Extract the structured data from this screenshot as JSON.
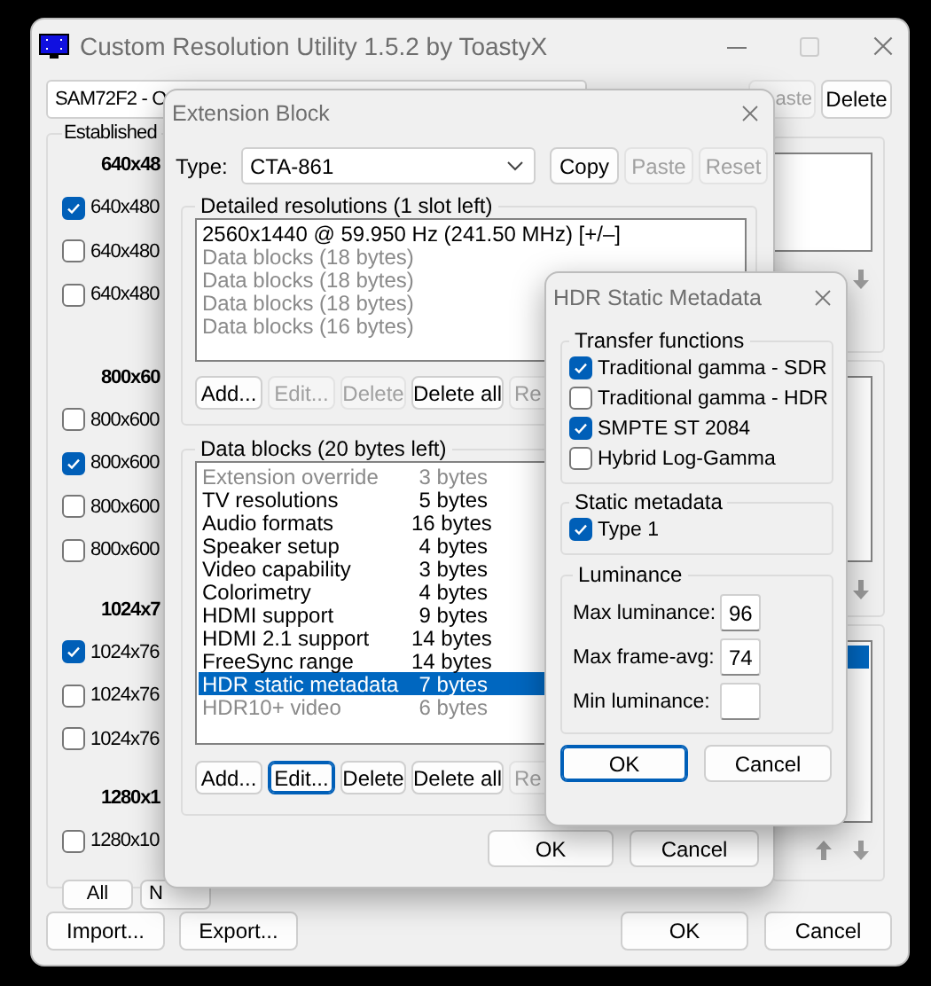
{
  "main_window": {
    "title": "Custom Resolution Utility 1.5.2 by ToastyX",
    "display_select": "SAM72F2 - O",
    "top_buttons": [
      {
        "label": "aste",
        "disabled": true
      },
      {
        "label": "Delete",
        "disabled": false
      }
    ],
    "established": {
      "title": "Established",
      "sections": [
        {
          "header": "640x48",
          "items": [
            {
              "label": "640x480",
              "checked": true
            },
            {
              "label": "640x480",
              "checked": false
            },
            {
              "label": "640x480",
              "checked": false
            }
          ]
        },
        {
          "header": "800x60",
          "items": [
            {
              "label": "800x600",
              "checked": false
            },
            {
              "label": "800x600",
              "checked": true
            },
            {
              "label": "800x600",
              "checked": false
            },
            {
              "label": "800x600",
              "checked": false
            }
          ]
        },
        {
          "header": "1024x7",
          "items": [
            {
              "label": "1024x76",
              "checked": true
            },
            {
              "label": "1024x76",
              "checked": false
            },
            {
              "label": "1024x76",
              "checked": false
            }
          ]
        },
        {
          "header": "1280x1",
          "items": [
            {
              "label": "1280x10",
              "checked": false
            }
          ]
        }
      ],
      "buttons": [
        "All",
        "N"
      ]
    },
    "right_panels": [
      {
        "highlighted_row": false
      },
      {
        "highlighted_row": false
      },
      {
        "highlighted_row": true
      }
    ],
    "footer_left": [
      "Import...",
      "Export..."
    ],
    "footer_right": [
      "OK",
      "Cancel"
    ]
  },
  "extension_block": {
    "title": "Extension Block",
    "type_label": "Type:",
    "type_value": "CTA-861",
    "type_buttons": [
      {
        "label": "Copy",
        "disabled": false
      },
      {
        "label": "Paste",
        "disabled": true
      },
      {
        "label": "Reset",
        "disabled": true
      }
    ],
    "detailed": {
      "title": "Detailed resolutions (1 slot left)",
      "rows": [
        {
          "text": "2560x1440 @ 59.950 Hz (241.50 MHz) [+/–]",
          "disabled": false
        },
        {
          "text": "Data blocks (18 bytes)",
          "disabled": true
        },
        {
          "text": "Data blocks (18 bytes)",
          "disabled": true
        },
        {
          "text": "Data blocks (18 bytes)",
          "disabled": true
        },
        {
          "text": "Data blocks (16 bytes)",
          "disabled": true
        }
      ],
      "buttons": [
        {
          "label": "Add...",
          "disabled": false
        },
        {
          "label": "Edit...",
          "disabled": true
        },
        {
          "label": "Delete",
          "disabled": true
        },
        {
          "label": "Delete all",
          "disabled": false
        },
        {
          "label": "Re",
          "disabled": true
        }
      ]
    },
    "data_blocks": {
      "title": "Data blocks (20 bytes left)",
      "rows": [
        {
          "name": "Extension override",
          "size": "3 bytes",
          "disabled": true,
          "selected": false
        },
        {
          "name": "TV resolutions",
          "size": "5 bytes",
          "disabled": false,
          "selected": false
        },
        {
          "name": "Audio formats",
          "size": "16 bytes",
          "disabled": false,
          "selected": false
        },
        {
          "name": "Speaker setup",
          "size": "4 bytes",
          "disabled": false,
          "selected": false
        },
        {
          "name": "Video capability",
          "size": "3 bytes",
          "disabled": false,
          "selected": false
        },
        {
          "name": "Colorimetry",
          "size": "4 bytes",
          "disabled": false,
          "selected": false
        },
        {
          "name": "HDMI support",
          "size": "9 bytes",
          "disabled": false,
          "selected": false
        },
        {
          "name": "HDMI 2.1 support",
          "size": "14 bytes",
          "disabled": false,
          "selected": false
        },
        {
          "name": "FreeSync range",
          "size": "14 bytes",
          "disabled": false,
          "selected": false
        },
        {
          "name": "HDR static metadata",
          "size": "7 bytes",
          "disabled": false,
          "selected": true
        },
        {
          "name": "HDR10+ video",
          "size": "6 bytes",
          "disabled": true,
          "selected": false
        }
      ],
      "buttons": [
        {
          "label": "Add...",
          "disabled": false,
          "focused": false
        },
        {
          "label": "Edit...",
          "disabled": false,
          "focused": true
        },
        {
          "label": "Delete",
          "disabled": false,
          "focused": false
        },
        {
          "label": "Delete all",
          "disabled": false,
          "focused": false
        },
        {
          "label": "Re",
          "disabled": true,
          "focused": false
        }
      ]
    },
    "footer_buttons": [
      "OK",
      "Cancel"
    ]
  },
  "hdr_dialog": {
    "title": "HDR Static Metadata",
    "transfer_functions": {
      "title": "Transfer functions",
      "items": [
        {
          "label": "Traditional gamma - SDR",
          "checked": true
        },
        {
          "label": "Traditional gamma - HDR",
          "checked": false
        },
        {
          "label": "SMPTE ST 2084",
          "checked": true
        },
        {
          "label": "Hybrid Log-Gamma",
          "checked": false
        }
      ]
    },
    "static_metadata": {
      "title": "Static metadata",
      "items": [
        {
          "label": "Type 1",
          "checked": true
        }
      ]
    },
    "luminance": {
      "title": "Luminance",
      "fields": [
        {
          "label": "Max luminance:",
          "value": "96"
        },
        {
          "label": "Max frame-avg:",
          "value": "74"
        },
        {
          "label": "Min luminance:"
        }
      ]
    },
    "buttons": [
      {
        "label": "OK",
        "default": true
      },
      {
        "label": "Cancel",
        "default": false
      }
    ]
  }
}
